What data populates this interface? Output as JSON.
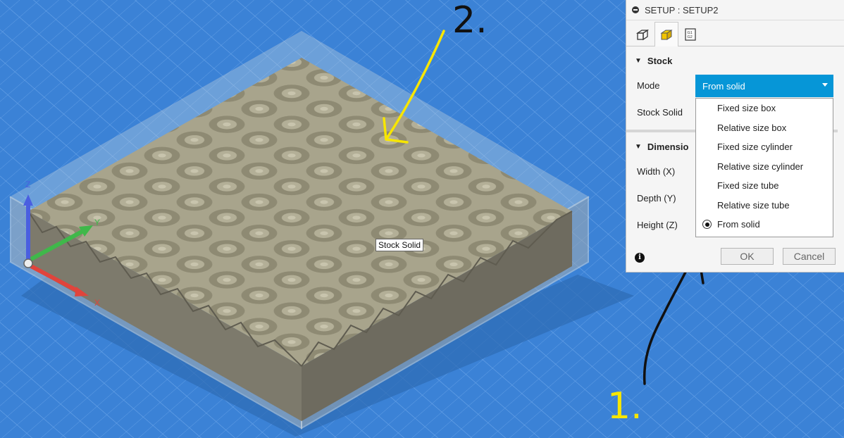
{
  "panel": {
    "title": "SETUP : SETUP2",
    "tabs": [
      {
        "icon": "setup-tab-icon"
      },
      {
        "icon": "stock-tab-icon"
      },
      {
        "icon": "post-process-tab-icon",
        "glyph": "G1\nG2"
      }
    ],
    "stock_section": "Stock",
    "mode_label": "Mode",
    "mode_value": "From solid",
    "stock_solid_label": "Stock Solid",
    "dimensions_section": "Dimensio",
    "width_label": "Width (X)",
    "depth_label": "Depth (Y)",
    "height_label": "Height (Z)",
    "ok_label": "OK",
    "cancel_label": "Cancel",
    "info_glyph": "i"
  },
  "dropdown": {
    "options": [
      "Fixed size box",
      "Relative size box",
      "Fixed size cylinder",
      "Relative size cylinder",
      "Fixed size tube",
      "Relative size tube",
      "From solid"
    ],
    "selected": "From solid"
  },
  "viewport": {
    "tooltip": "Stock Solid",
    "axes": {
      "x": "X",
      "y": "Y",
      "z": "Z"
    },
    "colors": {
      "background": "#3b82d6",
      "grid": "#6fa8ea",
      "model": "#9e9a82",
      "x_axis": "#e0443c",
      "y_axis": "#3fb84a",
      "z_axis": "#4a5fe0"
    }
  },
  "annotations": {
    "one": "1.",
    "two": "2."
  },
  "colors": {
    "accent": "#0696d7",
    "annotation_yellow": "#f7e600",
    "annotation_black": "#111111"
  }
}
